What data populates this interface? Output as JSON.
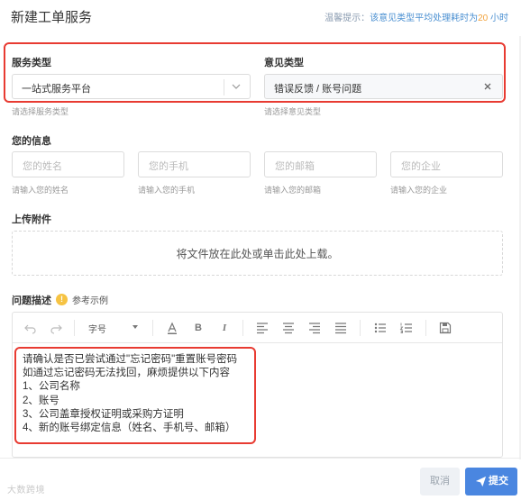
{
  "header": {
    "title": "新建工单服务",
    "tip_prefix": "温馨提示：",
    "tip_text": "该意见类型平均处理耗时为",
    "tip_num": "20",
    "tip_unit": " 小时"
  },
  "service_type": {
    "label": "服务类型",
    "value": "一站式服务平台",
    "hint": "请选择服务类型"
  },
  "feedback_type": {
    "label": "意见类型",
    "value": "错误反馈 / 账号问题",
    "hint": "请选择意见类型"
  },
  "your_info": {
    "label": "您的信息",
    "fields": [
      {
        "placeholder": "您的姓名",
        "hint": "请输入您的姓名"
      },
      {
        "placeholder": "您的手机",
        "hint": "请输入您的手机"
      },
      {
        "placeholder": "您的邮箱",
        "hint": "请输入您的邮箱"
      },
      {
        "placeholder": "您的企业",
        "hint": "请输入您的企业"
      }
    ]
  },
  "attachment": {
    "label": "上传附件",
    "dropzone_text": "将文件放在此处或单击此处上载。"
  },
  "description": {
    "label": "问题描述",
    "example_link": "参考示例",
    "font_size_label": "字号",
    "lines": [
      "请确认是否已尝试通过\"忘记密码\"重置账号密码",
      "如通过忘记密码无法找回，麻烦提供以下内容",
      "1、公司名称",
      "2、账号",
      "3、公司盖章授权证明或采购方证明",
      "4、新的账号绑定信息（姓名、手机号、邮箱）"
    ]
  },
  "footer": {
    "watermark": "大数跨境",
    "cancel_label": "取消",
    "submit_label": "提交"
  },
  "colors": {
    "highlight_red": "#e83b32",
    "primary_blue": "#4a86e0",
    "tip_orange": "#f2a23c"
  }
}
